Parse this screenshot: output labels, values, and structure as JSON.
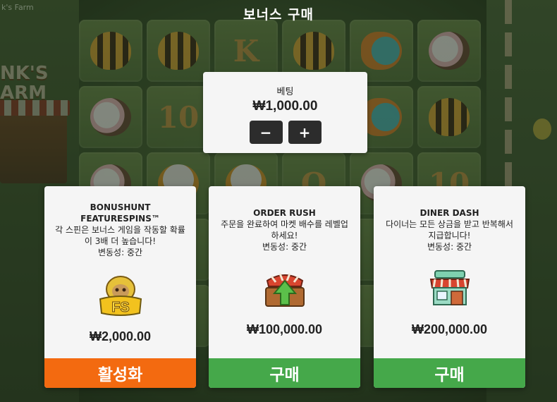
{
  "background": {
    "corner_title": "k's Farm",
    "logo_text": "NK'S\nARM"
  },
  "modal": {
    "title": "보너스 구매"
  },
  "bet": {
    "label": "베팅",
    "value": "₩1,000.00",
    "minus_label": "−",
    "plus_label": "+"
  },
  "cards": [
    {
      "name": "BONUSHUNT FEATURESPINS™",
      "description": "각 스핀은 보너스 게임을 작동할 확률이 3배 더 높습니다!",
      "volatility": "변동성: 중간",
      "icon": "sloth-fs-icon",
      "price": "₩2,000.00",
      "button_label": "활성화",
      "button_color": "#f36a10"
    },
    {
      "name": "ORDER RUSH",
      "description": "주문을 완료하여 마켓 배수를 레벨업하세요!",
      "volatility": "변동성: 중간",
      "icon": "crate-arrow-icon",
      "price": "₩100,000.00",
      "button_label": "구매",
      "button_color": "#45a84a"
    },
    {
      "name": "DINER DASH",
      "description": "다이너는 모든 상금을 받고 반복해서 지급합니다!",
      "volatility": "변동성: 중간",
      "icon": "diner-shop-icon",
      "price": "₩200,000.00",
      "button_label": "구매",
      "button_color": "#45a84a"
    }
  ]
}
